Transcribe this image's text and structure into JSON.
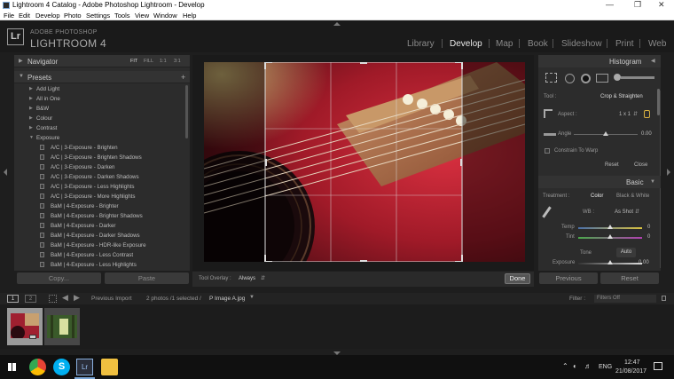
{
  "window": {
    "title": "Lightroom 4 Catalog - Adobe Photoshop Lightroom - Develop",
    "minimize": "—",
    "maximize": "❐",
    "close": "✕"
  },
  "menu": [
    "File",
    "Edit",
    "Develop",
    "Photo",
    "Settings",
    "Tools",
    "View",
    "Window",
    "Help"
  ],
  "identity": {
    "logo": "Lr",
    "brand_top": "ADOBE PHOTOSHOP",
    "brand_main": "LIGHTROOM 4"
  },
  "modules": [
    "Library",
    "Develop",
    "Map",
    "Book",
    "Slideshow",
    "Print",
    "Web"
  ],
  "active_module": "Develop",
  "left": {
    "navigator": {
      "title": "Navigator",
      "options": [
        "FIT",
        "FILL",
        "1:1",
        "3:1"
      ]
    },
    "presets": {
      "title": "Presets",
      "add": "+",
      "folders": [
        "Add Light",
        "All in One",
        "B&W",
        "Colour",
        "Contrast",
        "Exposure"
      ],
      "items": [
        "A/C | 3-Exposure - Brighten",
        "A/C | 3-Exposure - Brighten Shadows",
        "A/C | 3-Exposure - Darken",
        "A/C | 3-Exposure - Darken Shadows",
        "A/C | 3-Exposure - Less Highlights",
        "A/C | 3-Exposure - More Highlights",
        "BaM | 4-Exposure - Brighter",
        "BaM | 4-Exposure - Brighter Shadows",
        "BaM | 4-Exposure - Darker",
        "BaM | 4-Exposure - Darker Shadows",
        "BaM | 4-Exposure - HDR-like Exposure",
        "BaM | 4-Exposure - Less Contrast",
        "BaM | 4-Exposure - Less Highlights"
      ]
    },
    "copy_label": "Copy...",
    "paste_label": "Paste"
  },
  "toolbar": {
    "overlay_label": "Tool Overlay :",
    "overlay_value": "Always",
    "done_label": "Done"
  },
  "right": {
    "histogram_title": "Histogram",
    "tool_label": "Tool :",
    "tool_value": "Crop & Straighten",
    "aspect_label": "Aspect :",
    "aspect_value": "1 x 1",
    "angle_label": "Angle",
    "angle_value": "0.00",
    "angle_level": 0.5,
    "constrain_label": "Constrain To Warp",
    "reset_label": "Reset",
    "close_label": "Close",
    "basic_title": "Basic",
    "treatment_label": "Treatment :",
    "treatment_color": "Color",
    "treatment_bw": "Black & White",
    "wb_label": "WB :",
    "wb_value": "As Shot",
    "temp_label": "Temp",
    "temp_value": "0",
    "temp_level": 0.5,
    "tint_label": "Tint",
    "tint_value": "0",
    "tint_level": 0.5,
    "tone_label": "Tone",
    "auto_label": "Auto",
    "exposure_label": "Exposure",
    "exposure_value": "0.00",
    "exposure_level": 0.5,
    "previous_label": "Previous",
    "reset2_label": "Reset"
  },
  "filmbar": {
    "view1": "1",
    "view2": "2",
    "source": "Previous Import",
    "info": "2 photos /1 selected /",
    "filename": "P Image A.jpg",
    "filter_label": "Filter :",
    "filter_value": "Filters Off"
  },
  "taskbar": {
    "lang": "ENG",
    "time": "12:47",
    "date": "21/08/2017"
  },
  "colors": {
    "accent": "#e8e8e8",
    "panel": "#2c2c2c",
    "background": "#1e1e1e"
  }
}
